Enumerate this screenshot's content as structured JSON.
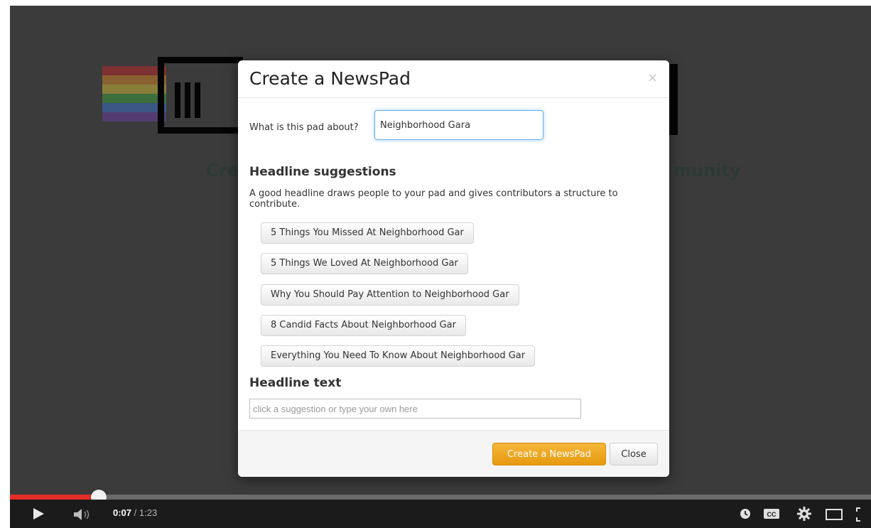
{
  "modal": {
    "title": "Create a NewsPad",
    "close_symbol": "×",
    "about_label": "What is this pad about?",
    "about_value": "Neighborhood Gara",
    "suggestions_heading": "Headline suggestions",
    "suggestions_help": "A good headline draws people to your pad and gives contributors a structure to contribute.",
    "suggestions": [
      "5 Things You Missed At Neighborhood Gar",
      "5 Things We Loved At Neighborhood Gar",
      "Why You Should Pay Attention to Neighborhood Gar",
      "8 Candid Facts About Neighborhood Gar",
      "Everything You Need To Know About Neighborhood Gar"
    ],
    "headline_heading": "Headline text",
    "headline_placeholder": "click a suggestion or type your own here",
    "create_button": "Create a NewsPad",
    "close_button": "Close"
  },
  "background": {
    "left_text": "Cre",
    "right_text": "munity"
  },
  "player": {
    "current_time": "0:07",
    "separator": " / ",
    "duration": "1:23",
    "progress_fraction": 0.101,
    "progress_color": "#e52d27",
    "icons": [
      "play-icon",
      "volume-icon",
      "watch-later-icon",
      "captions-icon",
      "settings-icon",
      "theater-mode-icon",
      "fullscreen-icon"
    ]
  }
}
